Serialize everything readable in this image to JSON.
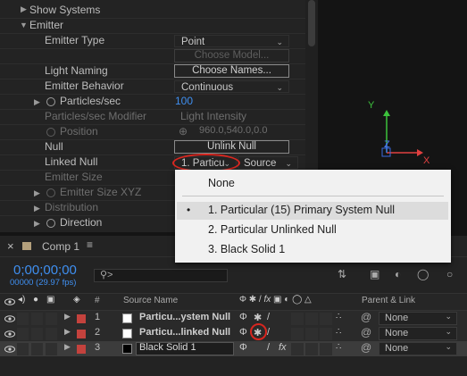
{
  "effect_controls": {
    "show_systems": "Show Systems",
    "emitter": "Emitter",
    "emitter_type": {
      "label": "Emitter Type",
      "value": "Point"
    },
    "choose_model": "Choose Model...",
    "light_naming": {
      "label": "Light Naming",
      "button": "Choose Names..."
    },
    "emitter_behavior": {
      "label": "Emitter Behavior",
      "value": "Continuous"
    },
    "particles_sec": {
      "label": "Particles/sec",
      "value": "100"
    },
    "particles_sec_modifier": {
      "label": "Particles/sec Modifier",
      "value": "Light Intensity"
    },
    "position": {
      "label": "Position",
      "value": "960.0,540.0,0.0"
    },
    "null": {
      "label": "Null",
      "button": "Unlink Null"
    },
    "linked_null": {
      "label": "Linked Null",
      "value": "1. Particu",
      "source": "Source"
    },
    "emitter_size": "Emitter Size",
    "emitter_size_xyz": "Emitter Size XYZ",
    "distribution": "Distribution",
    "direction": "Direction"
  },
  "viewer": {
    "axis_x": "X",
    "axis_y": "Y",
    "axis_z": "Z"
  },
  "menu": {
    "items": [
      "None",
      "1. Particular (15) Primary System Null",
      "2. Particular Unlinked Null",
      "3. Black Solid 1"
    ],
    "bullet": "•"
  },
  "timeline": {
    "comp_tab": "Comp 1",
    "timecode": "0;00;00;00",
    "frame_info": "00000 (29.97 fps)",
    "search_placeholder": "",
    "col_number": "#",
    "col_source": "Source Name",
    "col_parent": "Parent & Link",
    "layers": [
      {
        "num": "1",
        "name": "Particu...ystem Null",
        "color": "#c4423d",
        "parent": "None"
      },
      {
        "num": "2",
        "name": "Particu...linked Null",
        "color": "#c4423d",
        "parent": "None"
      },
      {
        "num": "3",
        "name": "Black Solid 1",
        "color": "#c4423d",
        "parent": "None"
      }
    ]
  },
  "colors": {
    "accent_blue": "#3f8ff0",
    "label_red": "#c4423d",
    "highlight_red": "#d8261f"
  }
}
